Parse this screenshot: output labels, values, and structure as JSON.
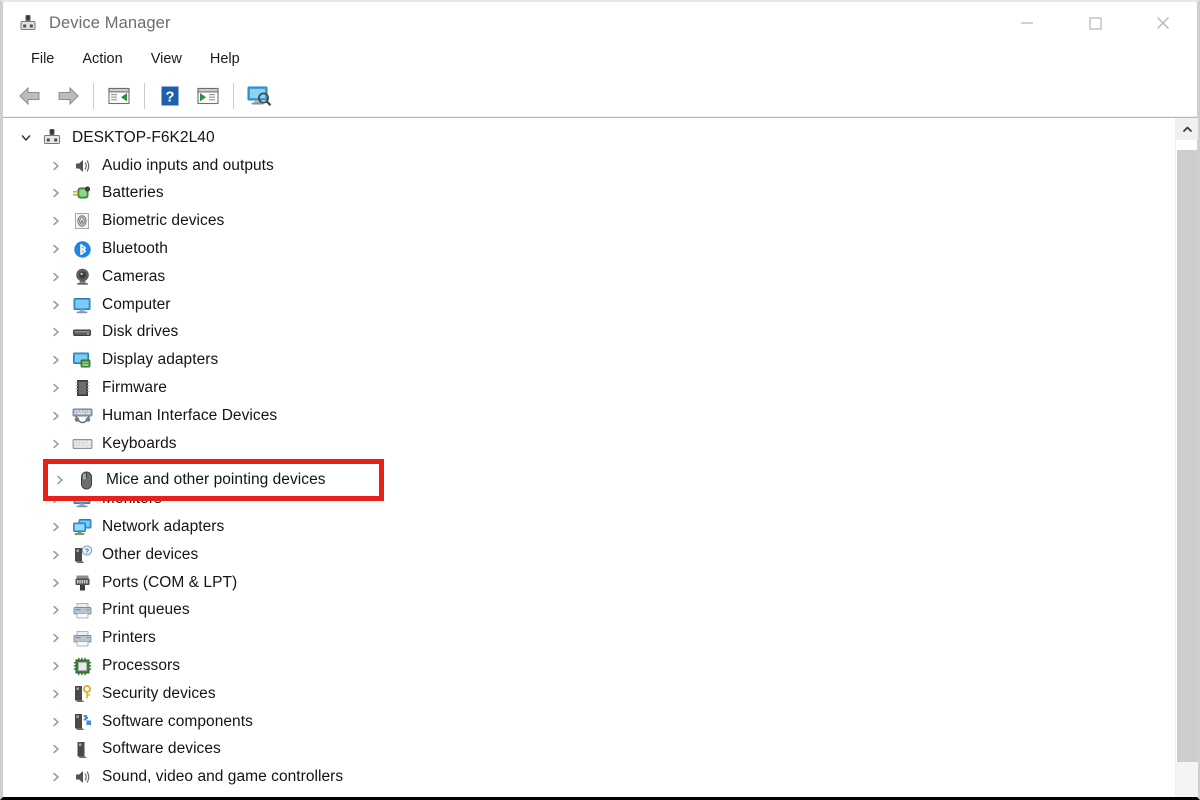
{
  "window": {
    "title": "Device Manager",
    "icon": "device-manager-icon",
    "controls": {
      "minimize": "minimize-button",
      "maximize": "maximize-button",
      "close": "close-button"
    }
  },
  "menubar": {
    "items": [
      {
        "label": "File"
      },
      {
        "label": "Action"
      },
      {
        "label": "View"
      },
      {
        "label": "Help"
      }
    ]
  },
  "toolbar": {
    "buttons": [
      {
        "name": "back-button",
        "icon": "back-arrow-icon"
      },
      {
        "name": "forward-button",
        "icon": "forward-arrow-icon"
      },
      {
        "name": "properties-button",
        "icon": "properties-window-icon"
      },
      {
        "name": "help-button",
        "icon": "help-question-icon"
      },
      {
        "name": "update-driver-button",
        "icon": "update-window-icon"
      },
      {
        "name": "scan-hardware-button",
        "icon": "scan-monitor-icon"
      }
    ]
  },
  "tree": {
    "root": {
      "label": "DESKTOP-F6K2L40",
      "icon": "computer-root-icon",
      "expanded": true
    },
    "items": [
      {
        "label": "Audio inputs and outputs",
        "icon": "speaker-icon"
      },
      {
        "label": "Batteries",
        "icon": "battery-icon"
      },
      {
        "label": "Biometric devices",
        "icon": "fingerprint-icon"
      },
      {
        "label": "Bluetooth",
        "icon": "bluetooth-icon"
      },
      {
        "label": "Cameras",
        "icon": "camera-icon"
      },
      {
        "label": "Computer",
        "icon": "monitor-icon"
      },
      {
        "label": "Disk drives",
        "icon": "disk-drive-icon"
      },
      {
        "label": "Display adapters",
        "icon": "display-adapter-icon"
      },
      {
        "label": "Firmware",
        "icon": "firmware-chip-icon"
      },
      {
        "label": "Human Interface Devices",
        "icon": "hid-keyboard-icon"
      },
      {
        "label": "Keyboards",
        "icon": "keyboard-icon"
      },
      {
        "label": "Mice and other pointing devices",
        "icon": "mouse-icon",
        "highlighted": true
      },
      {
        "label": "Monitors",
        "icon": "monitor-icon"
      },
      {
        "label": "Network adapters",
        "icon": "network-adapter-icon"
      },
      {
        "label": "Other devices",
        "icon": "other-device-question-icon"
      },
      {
        "label": "Ports (COM & LPT)",
        "icon": "port-connector-icon"
      },
      {
        "label": "Print queues",
        "icon": "printer-icon"
      },
      {
        "label": "Printers",
        "icon": "printer-icon"
      },
      {
        "label": "Processors",
        "icon": "processor-chip-icon"
      },
      {
        "label": "Security devices",
        "icon": "security-key-icon"
      },
      {
        "label": "Software components",
        "icon": "software-component-icon"
      },
      {
        "label": "Software devices",
        "icon": "software-device-icon"
      },
      {
        "label": "Sound, video and game controllers",
        "icon": "speaker-icon"
      }
    ]
  },
  "annotation": {
    "target_label": "Mice and other pointing devices",
    "color": "#e8201c"
  },
  "scrollbar": {
    "up_arrow": "scroll-up-arrow-icon"
  }
}
